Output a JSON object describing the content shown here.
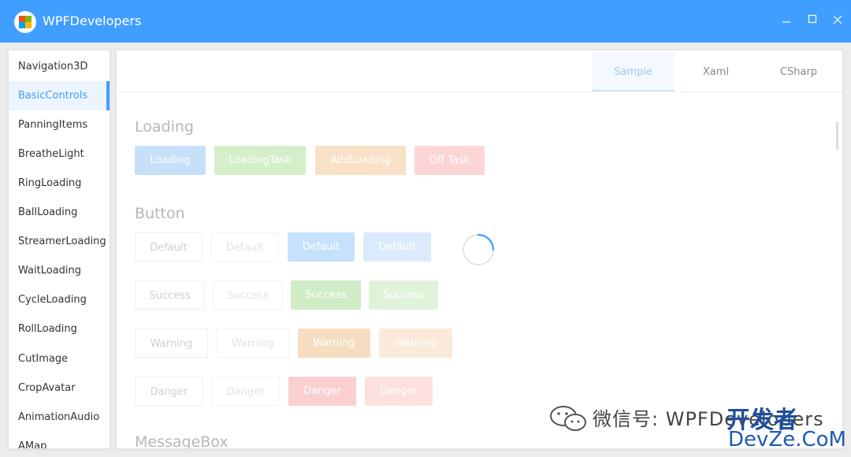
{
  "window": {
    "title": "WPFDevelopers"
  },
  "colors": {
    "accent": "#409eff",
    "success": "#67c23a",
    "warning": "#e6a23c",
    "danger": "#f56c6c"
  },
  "title_controls": [
    "minimize-icon",
    "maximize-icon",
    "close-icon"
  ],
  "sidebar": {
    "items": [
      {
        "label": "Navigation3D"
      },
      {
        "label": "BasicControls",
        "active": true
      },
      {
        "label": "PanningItems"
      },
      {
        "label": "BreatheLight"
      },
      {
        "label": "RingLoading"
      },
      {
        "label": "BallLoading"
      },
      {
        "label": "StreamerLoading"
      },
      {
        "label": "WaitLoading"
      },
      {
        "label": "CycleLoading"
      },
      {
        "label": "RollLoading"
      },
      {
        "label": "CutImage"
      },
      {
        "label": "CropAvatar"
      },
      {
        "label": "AnimationAudio"
      },
      {
        "label": "AMap"
      }
    ]
  },
  "tabs": [
    {
      "label": "Sample",
      "active": true
    },
    {
      "label": "Xaml"
    },
    {
      "label": "CSharp"
    }
  ],
  "sections": {
    "loading": {
      "title": "Loading",
      "buttons": [
        "Loading",
        "LoadingTask",
        "AddLoading",
        "Off Task"
      ]
    },
    "button": {
      "title": "Button",
      "rows": [
        [
          "Default",
          "Default",
          "Default",
          "Default"
        ],
        [
          "Success",
          "Success",
          "Success",
          "Success"
        ],
        [
          "Warning",
          "Warning",
          "Warning",
          "Warning"
        ],
        [
          "Danger",
          "Danger",
          "Danger",
          "Danger"
        ]
      ]
    },
    "messagebox": {
      "title": "MessageBox"
    }
  },
  "watermark": {
    "text": "微信号: WPFDevelopers",
    "cn": "开发者",
    "devze": "DevZe.CoM"
  }
}
